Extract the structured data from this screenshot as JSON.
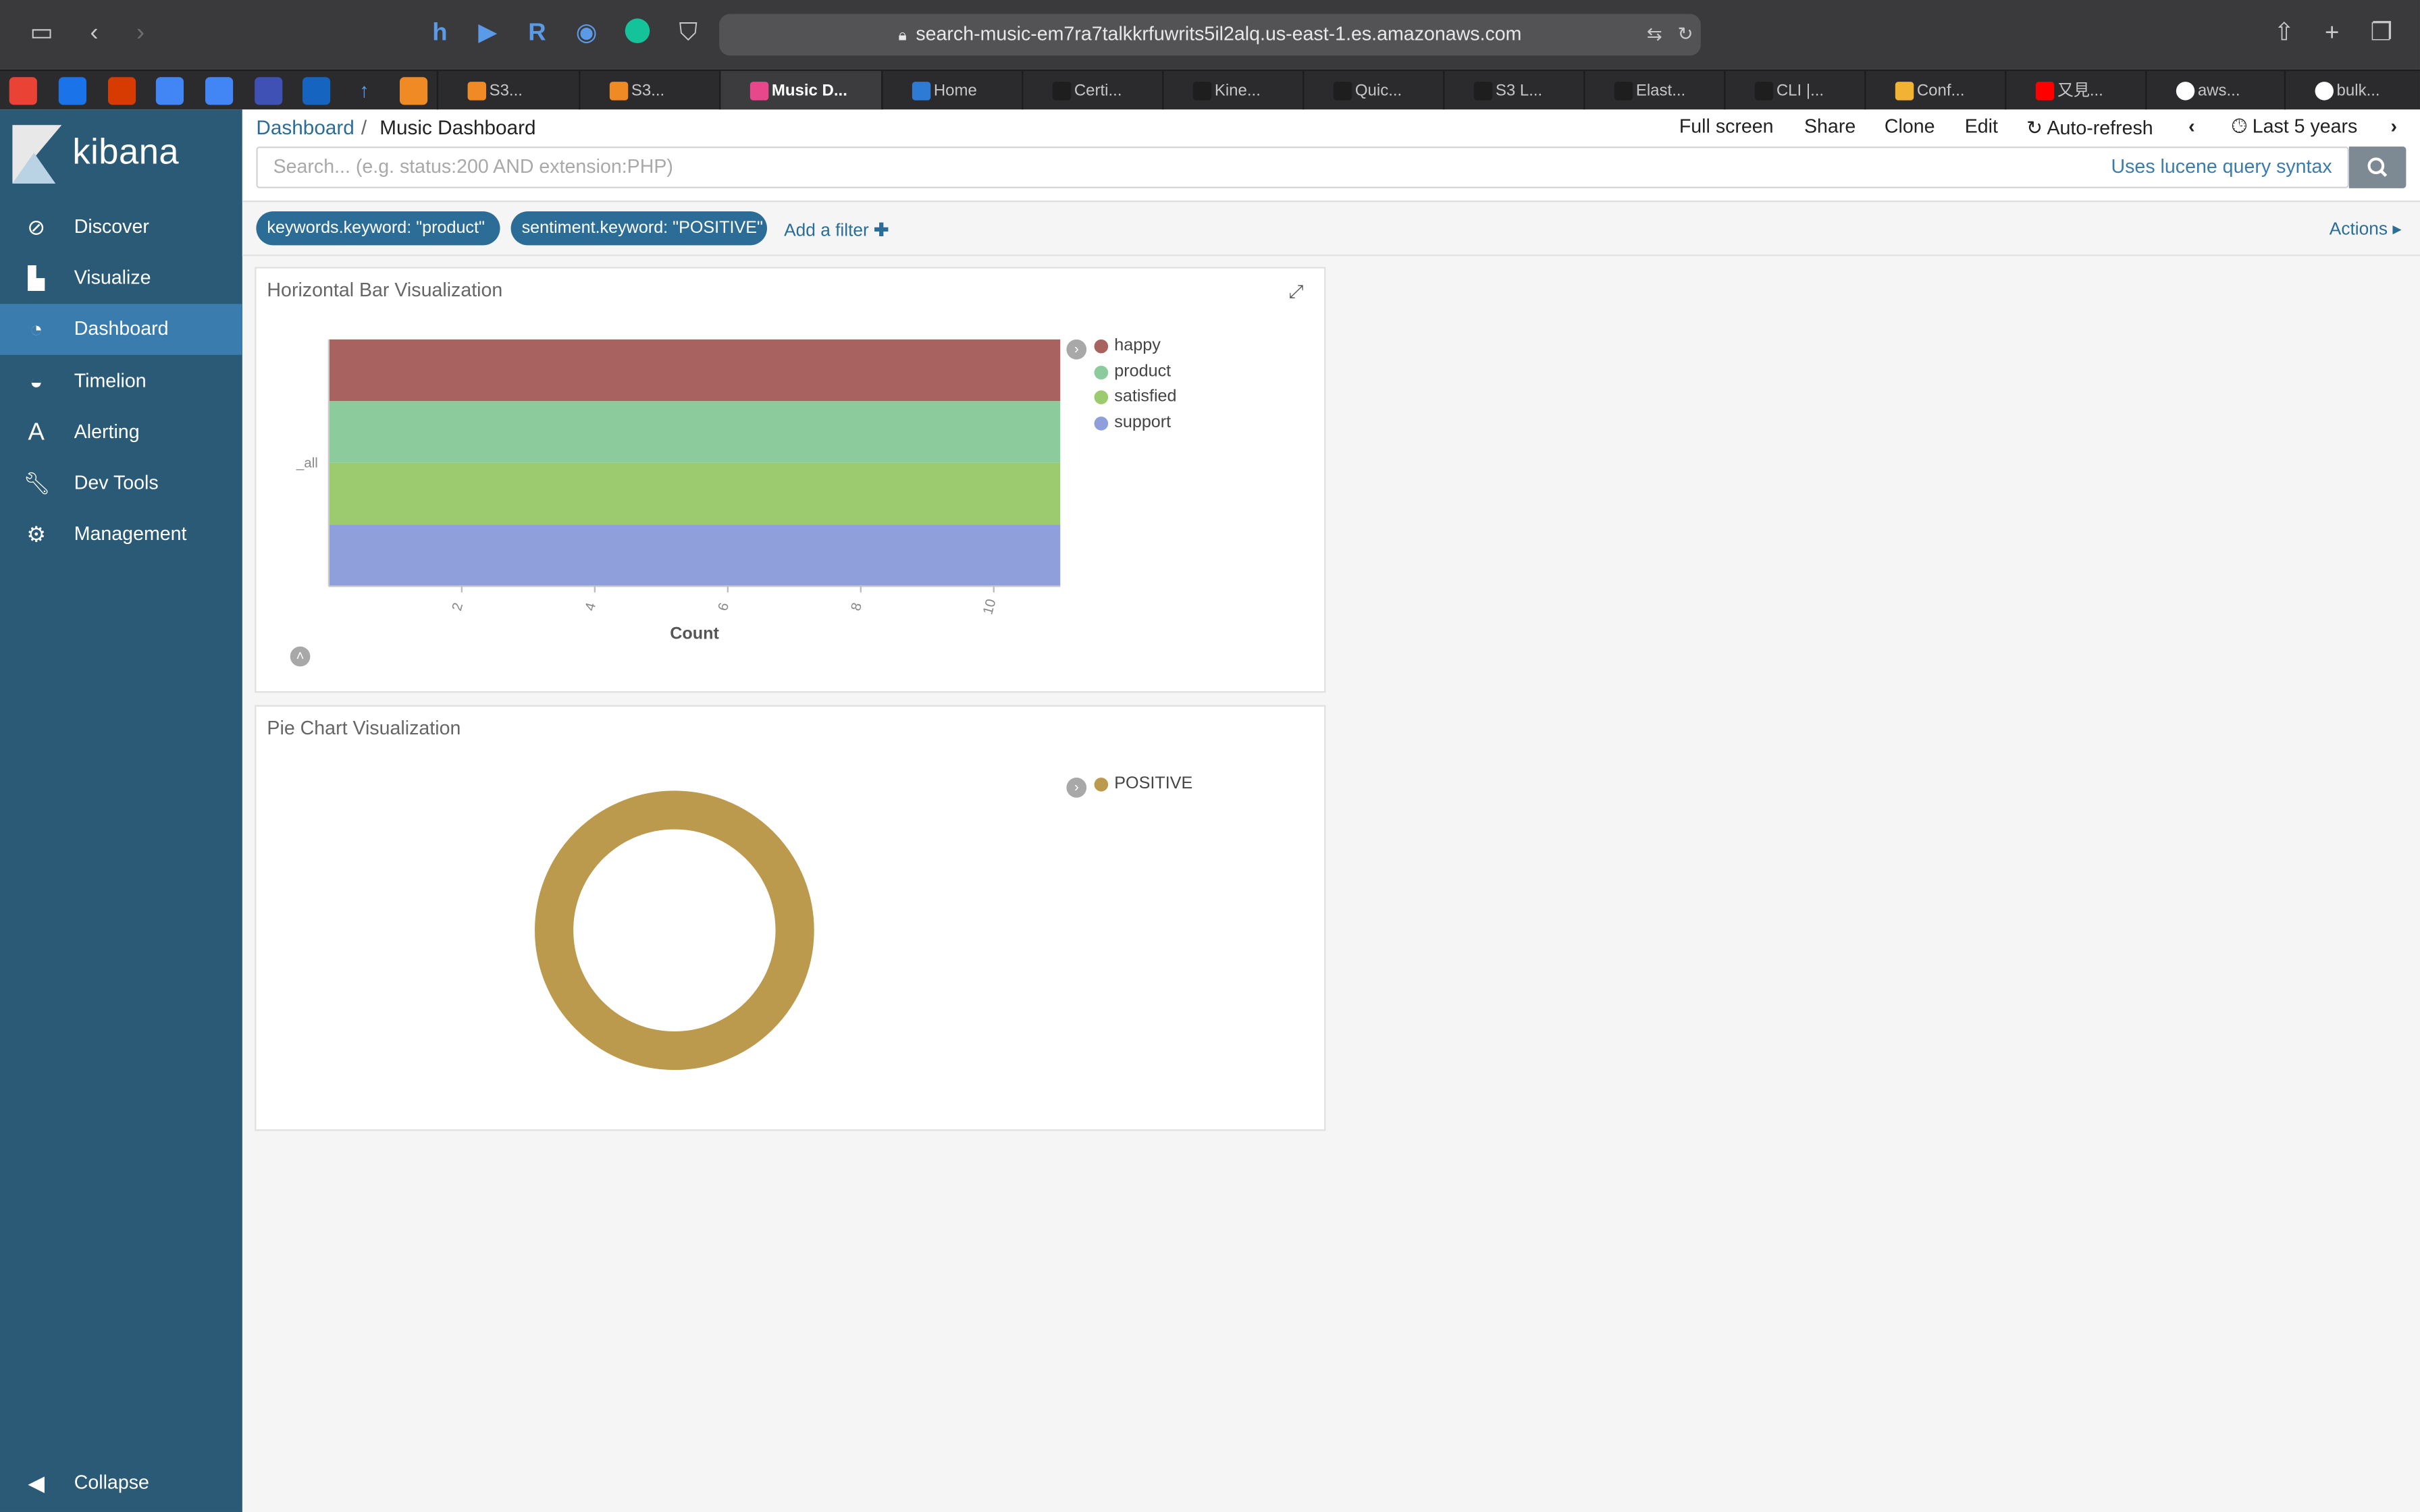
{
  "browser": {
    "url": "search-music-em7ra7talkkrfuwrits5il2alq.us-east-1.es.amazonaws.com",
    "tabs": [
      {
        "label": "S3..."
      },
      {
        "label": "S3..."
      },
      {
        "label": "Music D..."
      },
      {
        "label": "Home"
      },
      {
        "label": "Certi..."
      },
      {
        "label": "Kine..."
      },
      {
        "label": "Quic..."
      },
      {
        "label": "S3 L..."
      },
      {
        "label": "Elast..."
      },
      {
        "label": "CLI |..."
      },
      {
        "label": "Conf..."
      },
      {
        "label": "又見..."
      },
      {
        "label": "aws..."
      },
      {
        "label": "bulk..."
      }
    ]
  },
  "sidebar": {
    "brand": "kibana",
    "items": [
      {
        "label": "Discover",
        "icon": "compass-icon"
      },
      {
        "label": "Visualize",
        "icon": "bar-chart-icon"
      },
      {
        "label": "Dashboard",
        "icon": "dashboard-gauge-icon"
      },
      {
        "label": "Timelion",
        "icon": "timelion-mask-icon"
      },
      {
        "label": "Alerting",
        "icon": "alerting-a-icon"
      },
      {
        "label": "Dev Tools",
        "icon": "wrench-icon"
      },
      {
        "label": "Management",
        "icon": "gear-icon"
      }
    ],
    "collapse": "Collapse",
    "accent": "#2b5a77",
    "active_color": "#3a7cad"
  },
  "header": {
    "breadcrumb_root": "Dashboard",
    "breadcrumb_sep": "/",
    "breadcrumb_current": "Music Dashboard",
    "menu": {
      "fullscreen": "Full screen",
      "share": "Share",
      "clone": "Clone",
      "edit": "Edit",
      "autorefresh": "Auto-refresh",
      "timerange": "Last 5 years"
    }
  },
  "search": {
    "placeholder": "Search... (e.g. status:200 AND extension:PHP)",
    "syntax_link": "Uses lucene query syntax"
  },
  "filters": {
    "pills": [
      "keywords.keyword: \"product\"",
      "sentiment.keyword: \"POSITIVE\""
    ],
    "add": "Add a filter",
    "actions": "Actions"
  },
  "panels": {
    "bar": {
      "title": "Horizontal Bar Visualization"
    },
    "pie": {
      "title": "Pie Chart Visualization"
    }
  },
  "chart_data": [
    {
      "type": "bar",
      "orientation": "horizontal",
      "stacked": true,
      "categories": [
        "_all"
      ],
      "series": [
        {
          "name": "happy",
          "values": [
            11
          ],
          "color": "#a8625f"
        },
        {
          "name": "product",
          "values": [
            11
          ],
          "color": "#8ccb9c"
        },
        {
          "name": "satisfied",
          "values": [
            11
          ],
          "color": "#9cca6f"
        },
        {
          "name": "support",
          "values": [
            11
          ],
          "color": "#8e9fdc"
        }
      ],
      "xlabel": "Count",
      "xticks": [
        2,
        4,
        6,
        8,
        10
      ],
      "xlim": [
        0,
        11
      ],
      "legend": "right"
    },
    {
      "type": "pie",
      "donut": true,
      "slices": [
        {
          "name": "POSITIVE",
          "value": 1,
          "color": "#bc9a4d"
        }
      ],
      "legend": "right"
    }
  ]
}
